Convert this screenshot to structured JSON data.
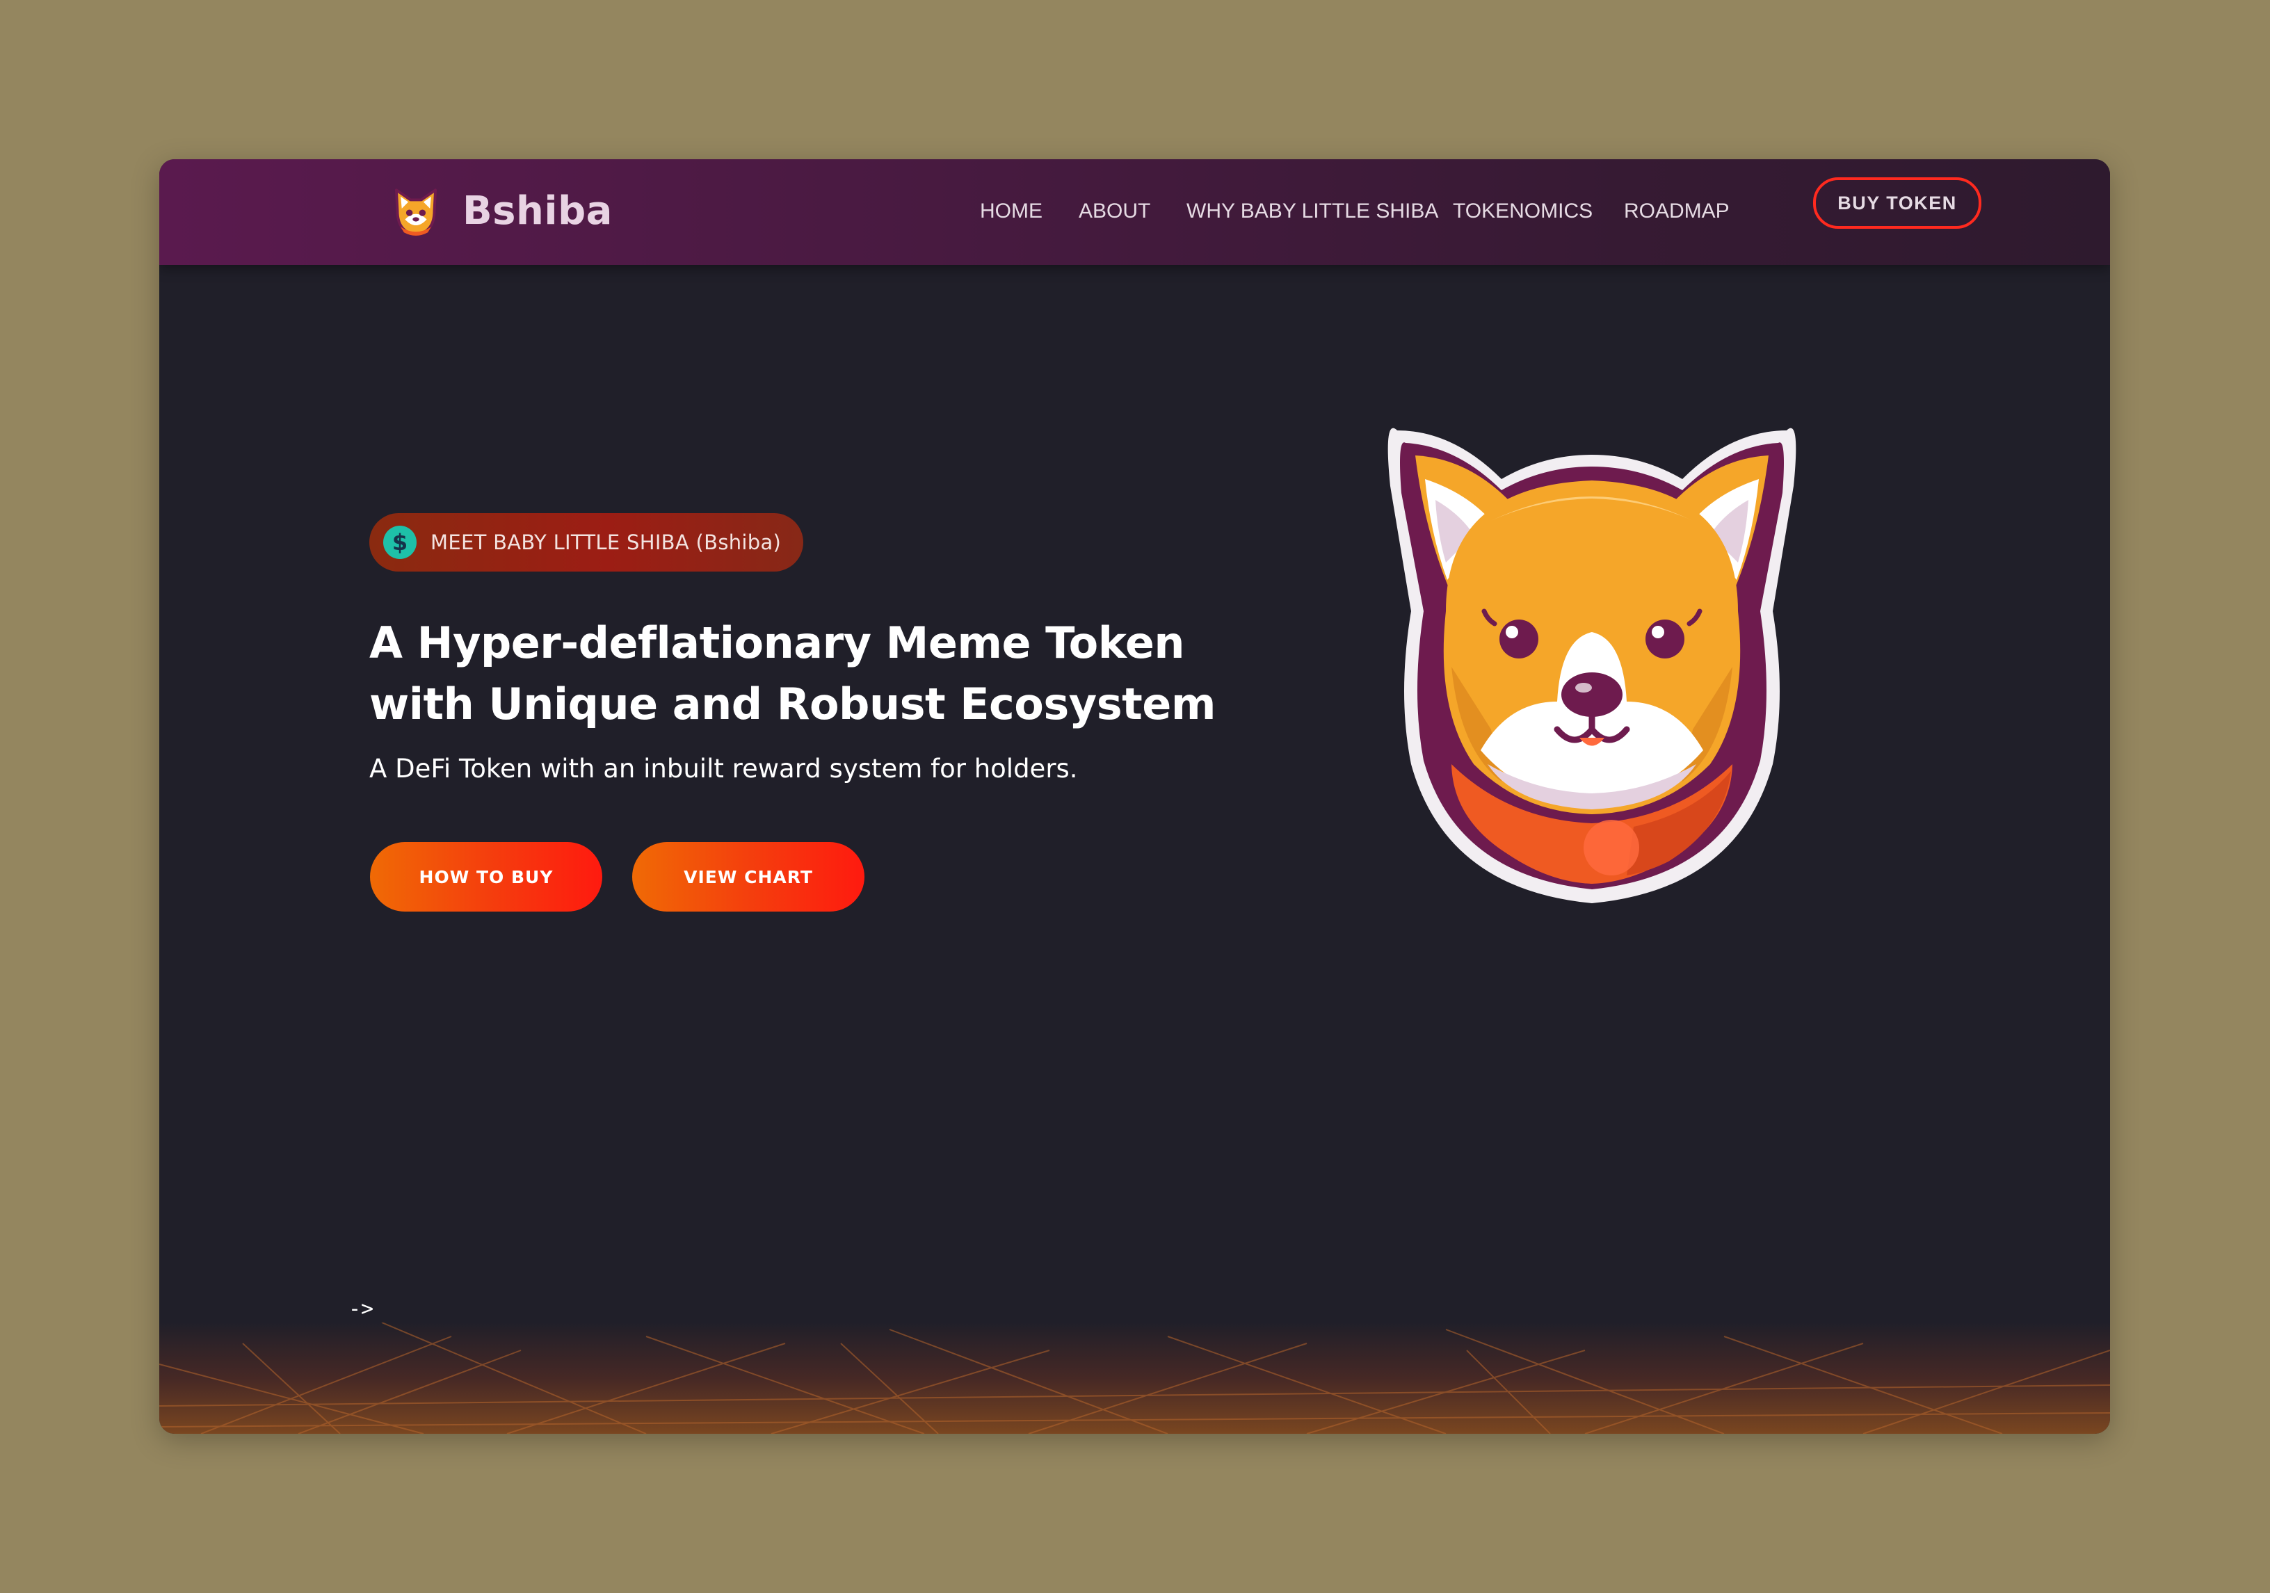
{
  "nav": {
    "brand_name": "Bshiba",
    "items": [
      {
        "label": "HOME"
      },
      {
        "label": "ABOUT"
      },
      {
        "label": "WHY BABY LITTLE SHIBA"
      },
      {
        "label": "TOKENOMICS"
      },
      {
        "label": "ROADMAP"
      }
    ],
    "buy_token_label": "BUY TOKEN"
  },
  "hero": {
    "badge_icon": "$",
    "badge_text": "MEET BABY LITTLE SHIBA (Bshiba)",
    "headline_line1": "A Hyper-deflationary Meme Token",
    "headline_line2": "with Unique and Robust Ecosystem",
    "subhead": "A DeFi Token with an inbuilt reward system for holders.",
    "how_to_buy_label": "HOW TO BUY",
    "view_chart_label": "VIEW CHART"
  },
  "footer_hint": "->",
  "colors": {
    "page_background": "#94865f",
    "hero_background": "#201f29",
    "nav_gradient_start": "#5a1a4e",
    "accent_orange": "#f06a05",
    "accent_red": "#ff1a0f",
    "badge_icon_teal": "#1ec0a8"
  },
  "icons": {
    "brand_logo": "shiba-face-icon",
    "badge": "dollar-coin-icon",
    "mascot": "shiba-mascot-illustration"
  }
}
